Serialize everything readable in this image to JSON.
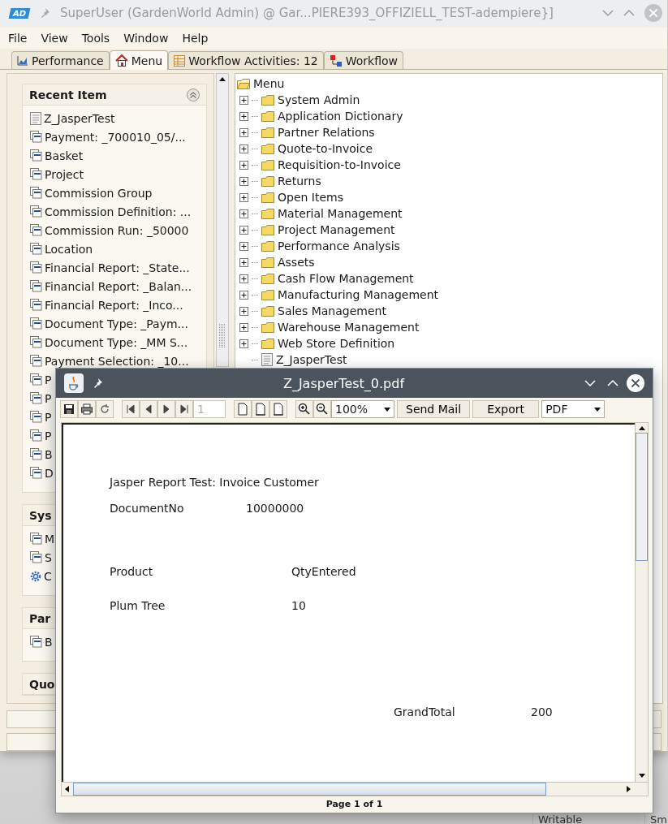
{
  "window": {
    "logo": "AD",
    "title": "SuperUser (GardenWorld Admin) @ Gar...PIERE393_OFFIZIELL_TEST-adempiere}]"
  },
  "menu_bar": [
    "File",
    "View",
    "Tools",
    "Window",
    "Help"
  ],
  "tabs": [
    {
      "label": "Performance",
      "kind": "chart",
      "selected": false
    },
    {
      "label": "Menu",
      "kind": "home",
      "selected": true
    },
    {
      "label": "Workflow Activities: 12",
      "kind": "table",
      "selected": false
    },
    {
      "label": "Workflow",
      "kind": "flow",
      "selected": false
    }
  ],
  "side_panels": [
    {
      "title": "Recent Item",
      "items": [
        {
          "label": "Z_JasperTest",
          "kind": "report"
        },
        {
          "label": "Payment: _700010_05/...",
          "kind": "window"
        },
        {
          "label": "Basket",
          "kind": "window"
        },
        {
          "label": "Project",
          "kind": "window"
        },
        {
          "label": "Commission Group",
          "kind": "window"
        },
        {
          "label": "Commission Definition: ...",
          "kind": "window"
        },
        {
          "label": "Commission Run: _50000",
          "kind": "window"
        },
        {
          "label": "Location",
          "kind": "window"
        },
        {
          "label": "Financial Report: _State...",
          "kind": "window"
        },
        {
          "label": "Financial Report: _Balan...",
          "kind": "window"
        },
        {
          "label": "Financial Report: _Inco...",
          "kind": "window"
        },
        {
          "label": "Document Type: _Paym...",
          "kind": "window"
        },
        {
          "label": "Document Type: _MM S...",
          "kind": "window"
        },
        {
          "label": "Payment Selection: _10...",
          "kind": "window"
        },
        {
          "label": "P",
          "kind": "window"
        },
        {
          "label": "P",
          "kind": "window"
        },
        {
          "label": "P",
          "kind": "window"
        },
        {
          "label": "P",
          "kind": "window"
        },
        {
          "label": "B",
          "kind": "window"
        },
        {
          "label": "D",
          "kind": "window"
        }
      ]
    },
    {
      "title": "Sys",
      "items": [
        {
          "label": "M",
          "kind": "window"
        },
        {
          "label": "S",
          "kind": "window"
        },
        {
          "label": "C",
          "kind": "process"
        }
      ]
    },
    {
      "title": "Par",
      "items": [
        {
          "label": "B",
          "kind": "window"
        }
      ]
    },
    {
      "title": "Quo"
    }
  ],
  "tree": {
    "label": "Menu",
    "children": [
      {
        "label": "System Admin",
        "kind": "folder",
        "expanded": false
      },
      {
        "label": "Application Dictionary",
        "kind": "folder",
        "expanded": false
      },
      {
        "label": "Partner Relations",
        "kind": "folder",
        "expanded": false
      },
      {
        "label": "Quote-to-Invoice",
        "kind": "folder",
        "expanded": false
      },
      {
        "label": "Requisition-to-Invoice",
        "kind": "folder",
        "expanded": false
      },
      {
        "label": "Returns",
        "kind": "folder",
        "expanded": false
      },
      {
        "label": "Open Items",
        "kind": "folder",
        "expanded": false
      },
      {
        "label": "Material Management",
        "kind": "folder",
        "expanded": false
      },
      {
        "label": "Project Management",
        "kind": "folder",
        "expanded": false
      },
      {
        "label": "Performance Analysis",
        "kind": "folder",
        "expanded": false
      },
      {
        "label": "Assets",
        "kind": "folder",
        "expanded": false
      },
      {
        "label": "Cash Flow Management",
        "kind": "folder",
        "expanded": false
      },
      {
        "label": "Manufacturing Management",
        "kind": "folder",
        "expanded": false
      },
      {
        "label": "Sales Management",
        "kind": "folder",
        "expanded": false
      },
      {
        "label": "Warehouse Management",
        "kind": "folder",
        "expanded": false
      },
      {
        "label": "Web Store Definition",
        "kind": "folder",
        "expanded": false
      },
      {
        "label": "Z_JasperTest",
        "kind": "report"
      }
    ]
  },
  "pdf_viewer": {
    "title": "Z_JasperTest_0.pdf",
    "page_field": "1",
    "zoom": "100%",
    "buttons": [
      "Send Mail",
      "Export"
    ],
    "format": "PDF",
    "report": {
      "title": "Jasper Report Test: Invoice Customer",
      "document_label": "DocumentNo",
      "document_no": "10000000",
      "columns": [
        "Product",
        "QtyEntered"
      ],
      "rows": [
        [
          "Plum Tree",
          "10"
        ]
      ],
      "total_label": "GrandTotal",
      "total": "200"
    },
    "page_status": "Page 1 of 1"
  },
  "background_status": [
    "Writable",
    "Sm"
  ]
}
